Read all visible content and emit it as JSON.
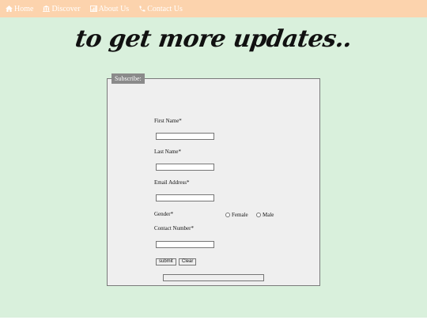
{
  "nav": {
    "items": [
      {
        "label": "Home",
        "icon": "home-icon"
      },
      {
        "label": "Discover",
        "icon": "bank-icon"
      },
      {
        "label": "About Us",
        "icon": "chart-icon"
      },
      {
        "label": "Contact Us",
        "icon": "phone-icon"
      }
    ]
  },
  "headline": "to get more updates..",
  "form": {
    "legend": "Subscribe:",
    "first_name_label": "First Name*",
    "last_name_label": "Last Name*",
    "email_label": "Email Address*",
    "gender_label": "Gender*",
    "female_label": "Female",
    "male_label": "Male",
    "contact_label": "Contact Number*",
    "submit_label": "submit",
    "clear_label": "Clear"
  },
  "colors": {
    "nav_bg": "#fcd3ad",
    "page_bg": "#d9f0dc",
    "legend_bg": "#8a8a8a",
    "form_bg": "#efefef"
  }
}
